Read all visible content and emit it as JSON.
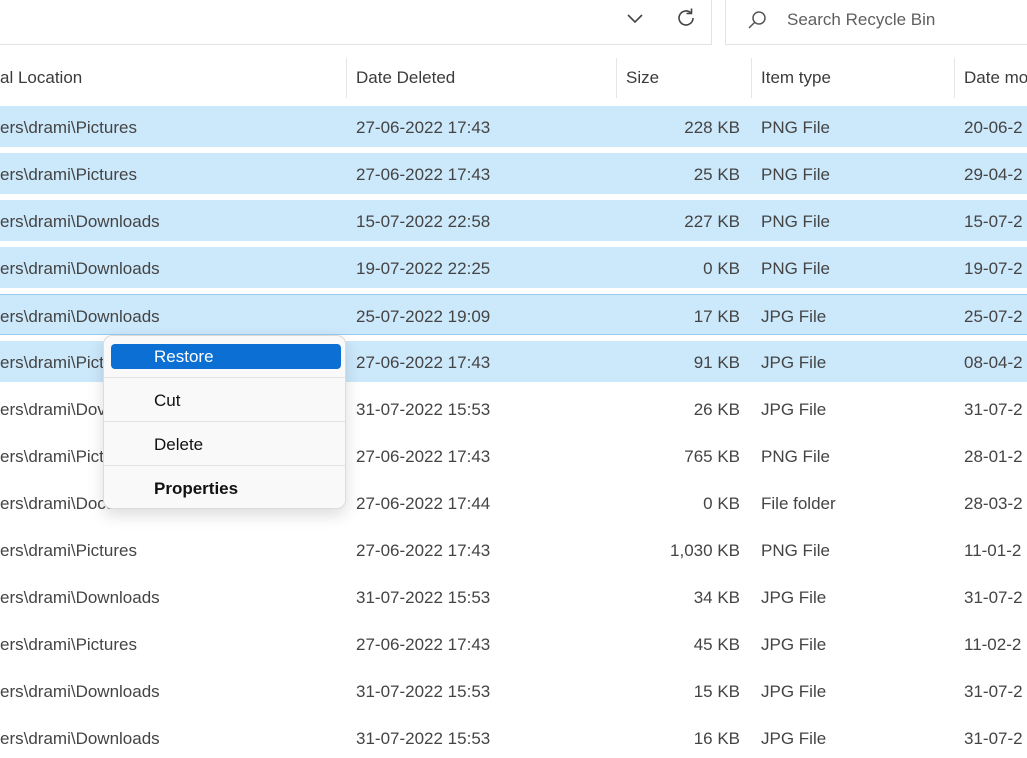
{
  "search": {
    "placeholder": "Search Recycle Bin"
  },
  "columns": {
    "location": "al Location",
    "date_deleted": "Date Deleted",
    "size": "Size",
    "item_type": "Item type",
    "date_modified": "Date mo"
  },
  "rows": [
    {
      "location": "ers\\drami\\Pictures",
      "date_deleted": "27-06-2022 17:43",
      "size": "228 KB",
      "type": "PNG File",
      "modified": "20-06-2",
      "state": "selected"
    },
    {
      "location": "ers\\drami\\Pictures",
      "date_deleted": "27-06-2022 17:43",
      "size": "25 KB",
      "type": "PNG File",
      "modified": "29-04-2",
      "state": "selected"
    },
    {
      "location": "ers\\drami\\Downloads",
      "date_deleted": "15-07-2022 22:58",
      "size": "227 KB",
      "type": "PNG File",
      "modified": "15-07-2",
      "state": "selected"
    },
    {
      "location": "ers\\drami\\Downloads",
      "date_deleted": "19-07-2022 22:25",
      "size": "0 KB",
      "type": "PNG File",
      "modified": "19-07-2",
      "state": "selected"
    },
    {
      "location": "ers\\drami\\Downloads",
      "date_deleted": "25-07-2022 19:09",
      "size": "17 KB",
      "type": "JPG File",
      "modified": "25-07-2",
      "state": "focused"
    },
    {
      "location": "ers\\drami\\Pict",
      "date_deleted": "27-06-2022 17:43",
      "size": "91 KB",
      "type": "JPG File",
      "modified": "08-04-2",
      "state": "selected"
    },
    {
      "location": "ers\\drami\\Dov",
      "date_deleted": "31-07-2022 15:53",
      "size": "26 KB",
      "type": "JPG File",
      "modified": "31-07-2",
      "state": "normal"
    },
    {
      "location": "ers\\drami\\Pict",
      "date_deleted": "27-06-2022 17:43",
      "size": "765 KB",
      "type": "PNG File",
      "modified": "28-01-2",
      "state": "normal"
    },
    {
      "location": "ers\\drami\\Documents",
      "date_deleted": "27-06-2022 17:44",
      "size": "0 KB",
      "type": "File folder",
      "modified": "28-03-2",
      "state": "normal"
    },
    {
      "location": "ers\\drami\\Pictures",
      "date_deleted": "27-06-2022 17:43",
      "size": "1,030 KB",
      "type": "PNG File",
      "modified": "11-01-2",
      "state": "normal"
    },
    {
      "location": "ers\\drami\\Downloads",
      "date_deleted": "31-07-2022 15:53",
      "size": "34 KB",
      "type": "JPG File",
      "modified": "31-07-2",
      "state": "normal"
    },
    {
      "location": "ers\\drami\\Pictures",
      "date_deleted": "27-06-2022 17:43",
      "size": "45 KB",
      "type": "JPG File",
      "modified": "11-02-2",
      "state": "normal"
    },
    {
      "location": "ers\\drami\\Downloads",
      "date_deleted": "31-07-2022 15:53",
      "size": "15 KB",
      "type": "JPG File",
      "modified": "31-07-2",
      "state": "normal"
    },
    {
      "location": "ers\\drami\\Downloads",
      "date_deleted": "31-07-2022 15:53",
      "size": "16 KB",
      "type": "JPG File",
      "modified": "31-07-2",
      "state": "normal"
    }
  ],
  "context_menu": {
    "restore": "Restore",
    "cut": "Cut",
    "delete": "Delete",
    "properties": "Properties"
  },
  "icons": {
    "chevron": "chevron-down-icon",
    "refresh": "refresh-icon",
    "search": "search-icon"
  },
  "colors": {
    "selection": "#cce8fb",
    "menu_highlight": "#0b6fd3"
  }
}
